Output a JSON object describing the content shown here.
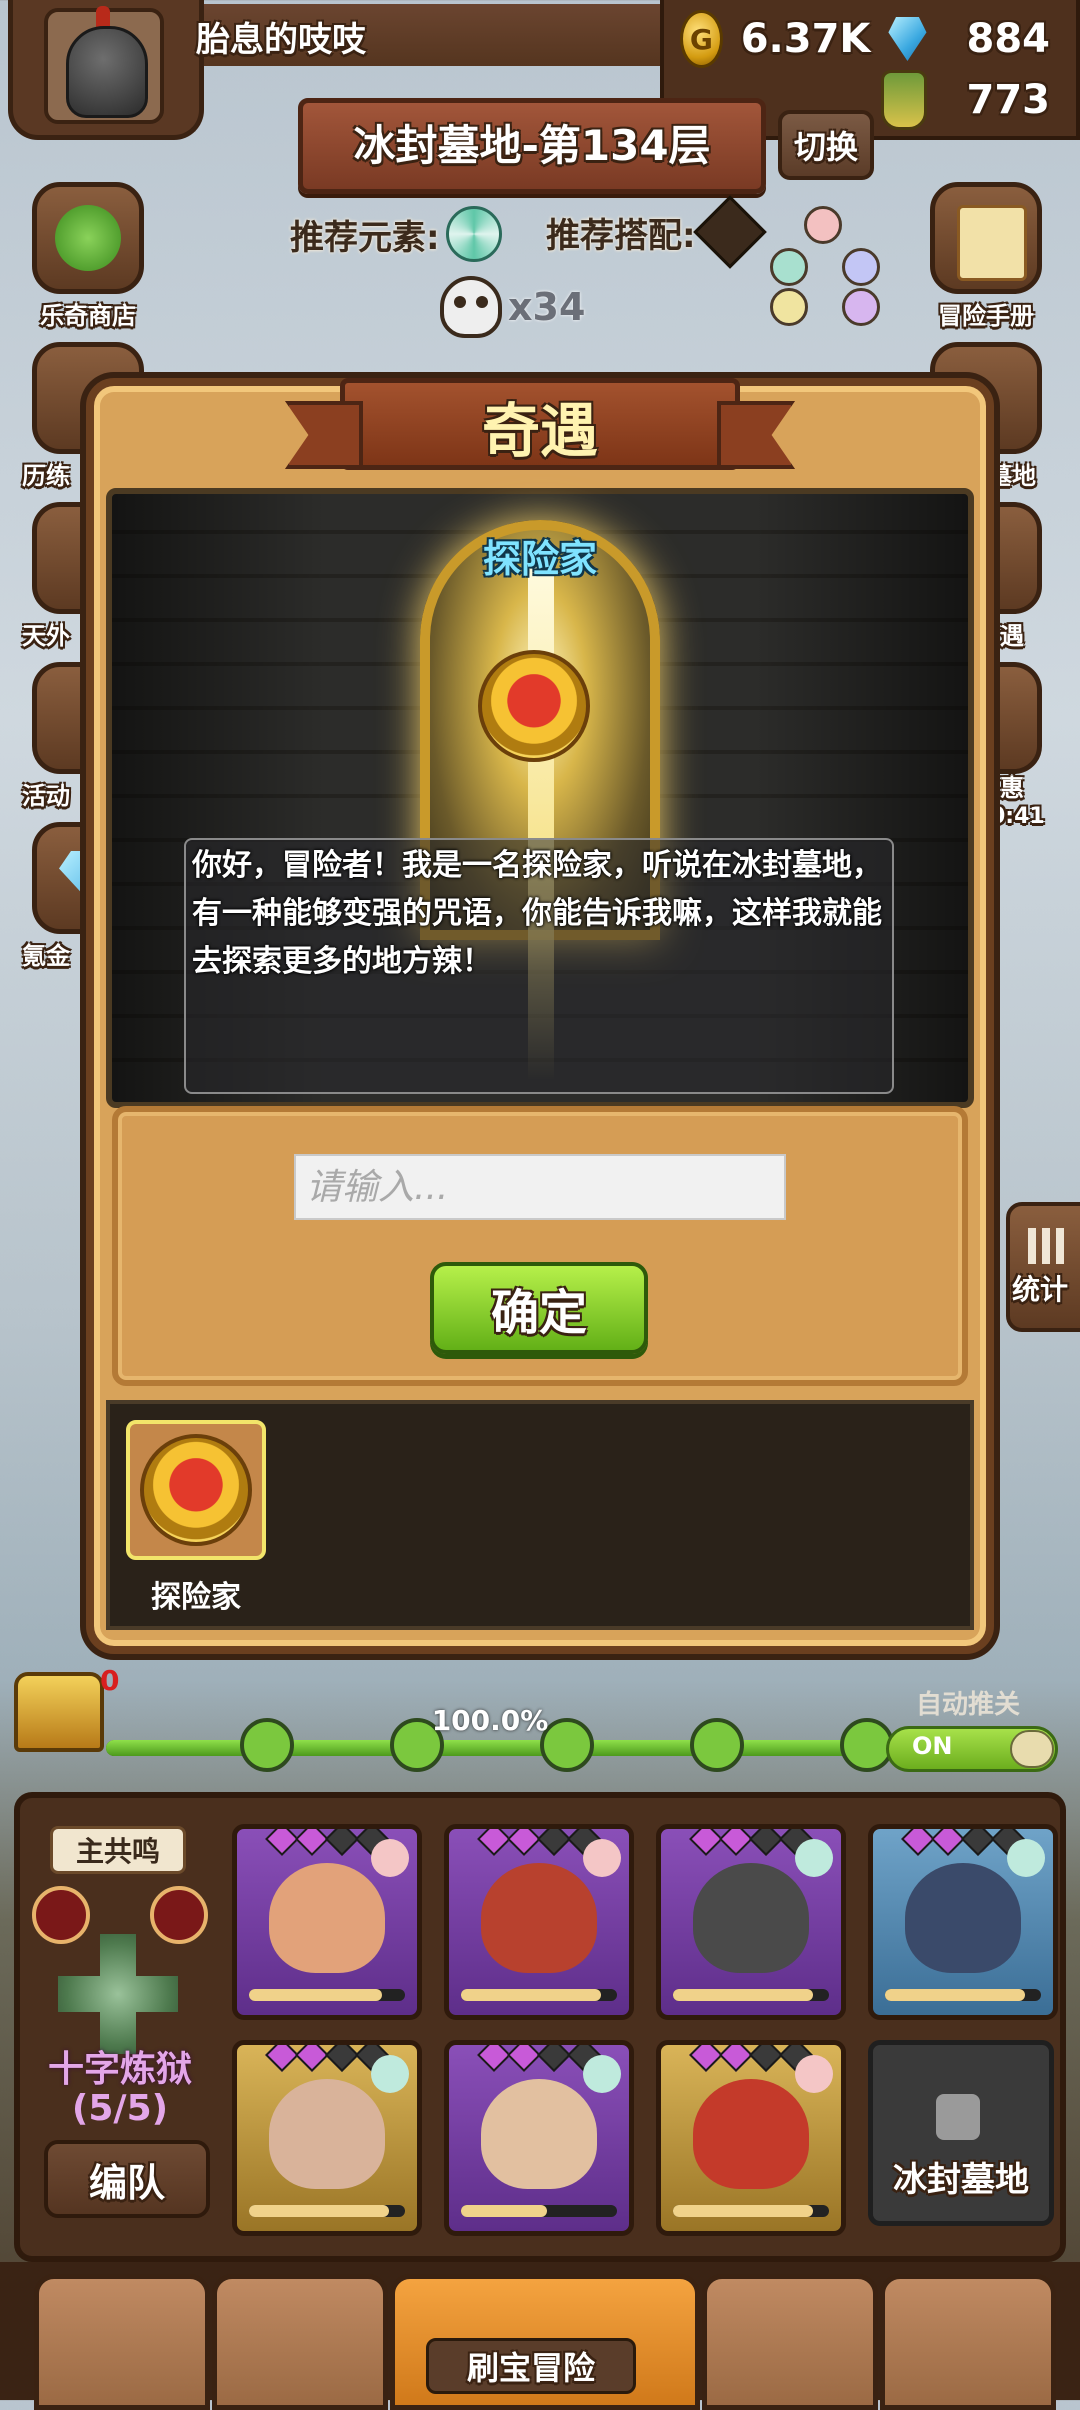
{
  "player": {
    "name": "胎息的吱吱"
  },
  "resources": {
    "gold": "6.37K",
    "gems": "884",
    "potion": "773",
    "gold_icon_letter": "G"
  },
  "level": {
    "title": "冰封墓地-第134层",
    "switch_label": "切换"
  },
  "recommend": {
    "element_label": "推荐元素:",
    "combo_label": "推荐搭配:"
  },
  "skull": {
    "count": "x34"
  },
  "left_menu": [
    {
      "label": "乐奇商店"
    },
    {
      "label": "历练"
    },
    {
      "label": "天外"
    },
    {
      "label": "活动"
    },
    {
      "label": "氪金"
    }
  ],
  "right_menu": [
    {
      "label": "冒险手册"
    },
    {
      "label": "墓地"
    },
    {
      "label": "遇"
    },
    {
      "label": "惠"
    }
  ],
  "right_timer": "0:41",
  "stats": {
    "label": "统计"
  },
  "modal": {
    "title": "奇遇",
    "npc_name": "探险家",
    "dialog": "你好，冒险者！我是一名探险家，听说在冰封墓地，有一种能够变强的咒语，你能告诉我嘛，这样我就能去探索更多的地方辣！",
    "input_placeholder": "请输入...",
    "confirm_label": "确定",
    "event_label": "探险家"
  },
  "progress": {
    "percent_text": "100.0%",
    "fraction": 1.0,
    "chest_count": "0",
    "auto_label": "自动推关",
    "auto_state": "ON"
  },
  "team": {
    "resonance_label": "主共鸣",
    "formation_name": "十字炼狱",
    "formation_count": "(5/5)",
    "edit_label": "编队",
    "locked_label": "冰封墓地",
    "heroes": [
      {
        "rarity": "purple",
        "element": "fire",
        "hp": 0.85
      },
      {
        "rarity": "purple",
        "element": "fire",
        "hp": 0.9
      },
      {
        "rarity": "purple",
        "element": "wind",
        "hp": 0.9
      },
      {
        "rarity": "blue",
        "element": "wind",
        "hp": 0.9
      },
      {
        "rarity": "gold",
        "element": "wind",
        "hp": 0.9
      },
      {
        "rarity": "purple",
        "element": "wind",
        "hp": 0.55
      },
      {
        "rarity": "gold",
        "element": "fire",
        "hp": 0.9
      }
    ]
  },
  "bottom_nav": {
    "active_label": "刷宝冒险"
  },
  "colors": {
    "modal_bg": "#d8a35a",
    "confirm_green": "#7cc42a",
    "npc_name_cyan": "#7fe3ff",
    "formation_purple": "#e3a6e8"
  }
}
